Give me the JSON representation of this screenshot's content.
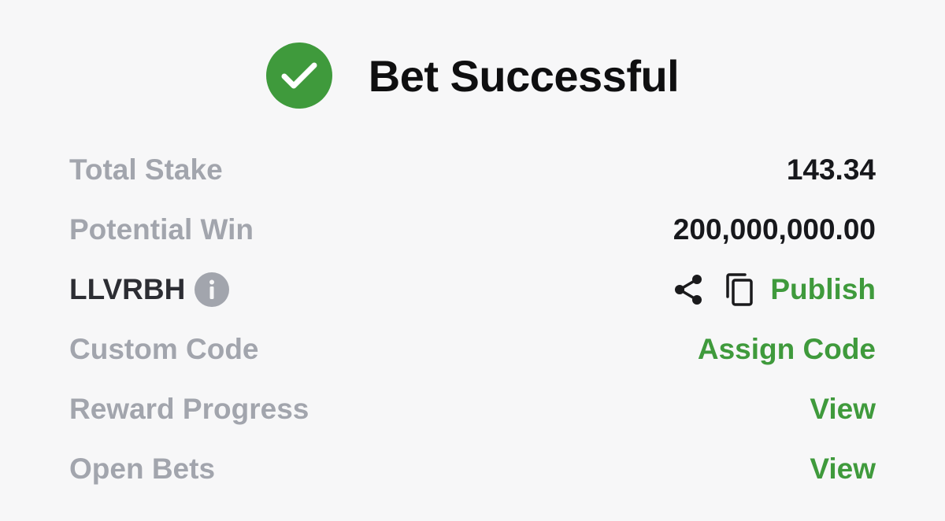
{
  "header": {
    "title": "Bet Successful",
    "icon": "check-circle-icon",
    "icon_color": "#3f9a3c"
  },
  "summary": {
    "total_stake": {
      "label": "Total Stake",
      "value": "143.34"
    },
    "potential_win": {
      "label": "Potential Win",
      "value": "200,000,000.00"
    },
    "booking": {
      "code": "LLVRBH",
      "info_icon": "info-icon",
      "share_icon": "share-icon",
      "copy_icon": "copy-icon",
      "publish_label": "Publish"
    },
    "custom_code": {
      "label": "Custom Code",
      "action": "Assign Code"
    },
    "reward_progress": {
      "label": "Reward Progress",
      "action": "View"
    },
    "open_bets": {
      "label": "Open Bets",
      "action": "View"
    }
  },
  "colors": {
    "accent": "#3f9a3c",
    "label": "#a2a5ad",
    "value": "#17181c",
    "background": "#f7f7f8"
  }
}
